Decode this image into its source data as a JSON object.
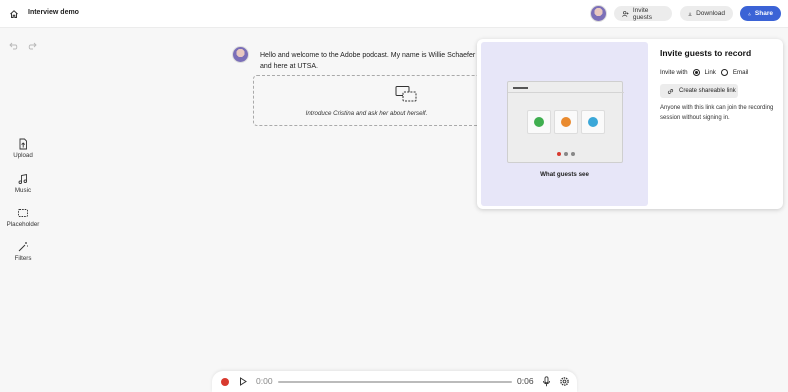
{
  "header": {
    "title": "Interview demo",
    "invite_label": "Invite guests",
    "download_label": "Download",
    "share_label": "Share",
    "accent_color": "#3b63d6"
  },
  "toolbar": {
    "undo_icon": "undo-icon",
    "redo_icon": "redo-icon",
    "tools": [
      {
        "label": "Upload",
        "icon": "upload-icon"
      },
      {
        "label": "Music",
        "icon": "music-icon"
      },
      {
        "label": "Placeholder",
        "icon": "placeholder-icon"
      },
      {
        "label": "Filters",
        "icon": "magic-wand-icon"
      }
    ]
  },
  "transcript": {
    "text": "Hello and welcome to the Adobe podcast. My name is Willie Schaefer and here at UTSA.",
    "placeholder_text": "Introduce Cristina and ask her about herself."
  },
  "invite_panel": {
    "title": "Invite guests to record",
    "invite_with_label": "Invite with",
    "option_link": "Link",
    "option_email": "Email",
    "selected_option": "Link",
    "create_link_label": "Create shareable link",
    "note": "Anyone with this link can join the recording session without signing in.",
    "preview_caption": "What guests see",
    "preview_bg": "#e7e6f8"
  },
  "player": {
    "current_time": "0:00",
    "total_time": "0:06",
    "record_color": "#d83a2f"
  }
}
